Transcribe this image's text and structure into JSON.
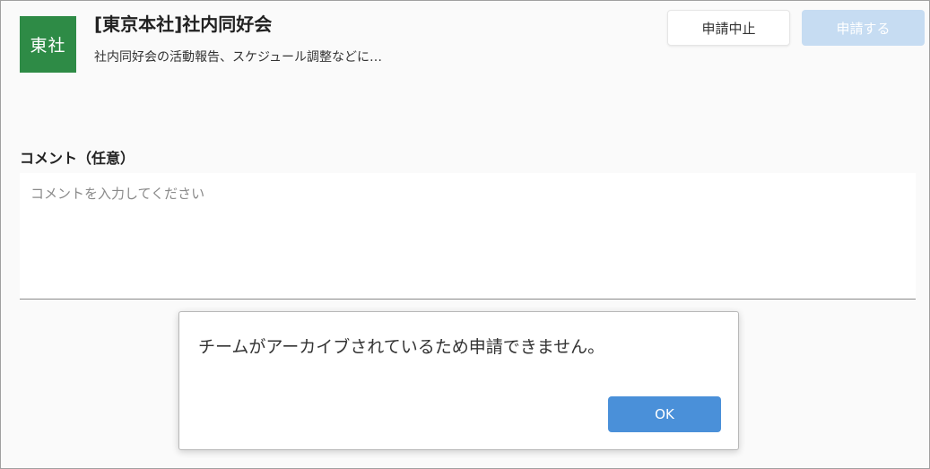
{
  "team": {
    "avatar_text": "東社",
    "avatar_color": "#2e8b46",
    "title": "[東京本社]社内同好会",
    "description": "社内同好会の活動報告、スケジュール調整などに…"
  },
  "actions": {
    "cancel_label": "申請中止",
    "apply_label": "申請する",
    "apply_color": "#c6dcf2"
  },
  "comment": {
    "label": "コメント（任意）",
    "value": "",
    "placeholder": "コメントを入力してください"
  },
  "dialog": {
    "message": "チームがアーカイブされているため申請できません。",
    "ok_label": "OK",
    "ok_color": "#4a90d9"
  }
}
